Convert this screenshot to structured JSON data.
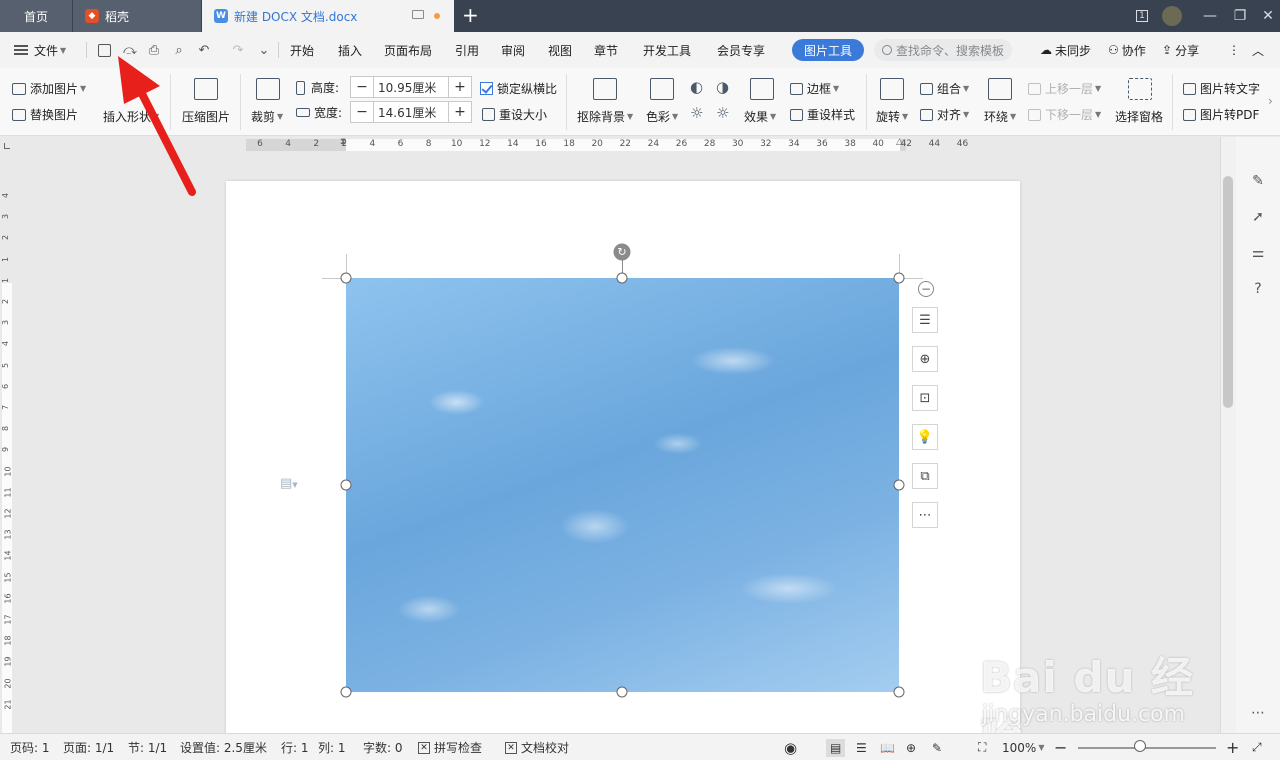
{
  "tabs": {
    "home": "首页",
    "daoke": "稻壳",
    "doc": "新建 DOCX 文档.docx",
    "doc_logo": "W"
  },
  "window": {
    "page_indicator": "1"
  },
  "menu": {
    "file": "文件",
    "items": [
      "开始",
      "插入",
      "页面布局",
      "引用",
      "审阅",
      "视图",
      "章节",
      "开发工具",
      "会员专享"
    ],
    "active_tab": "图片工具",
    "search_placeholder": "查找命令、搜索模板",
    "sync": "未同步",
    "collab": "协作",
    "share": "分享"
  },
  "toolbar": {
    "add_image": "添加图片",
    "replace_image": "替换图片",
    "insert_shape": "插入形状",
    "compress": "压缩图片",
    "crop": "裁剪",
    "height_label": "高度:",
    "height_value": "10.95厘米",
    "width_label": "宽度:",
    "width_value": "14.61厘米",
    "lock_ratio": "锁定纵横比",
    "reset_size": "重设大小",
    "remove_bg": "抠除背景",
    "color": "色彩",
    "effect": "效果",
    "border": "边框",
    "reset_style": "重设样式",
    "rotate": "旋转",
    "group": "组合",
    "align": "对齐",
    "wrap": "环绕",
    "bring_forward": "上移一层",
    "send_backward": "下移一层",
    "selection_pane": "选择窗格",
    "img_to_text": "图片转文字",
    "img_to_pdf": "图片转PDF"
  },
  "ruler_h": [
    "6",
    "4",
    "2",
    "2",
    "4",
    "6",
    "8",
    "10",
    "12",
    "14",
    "16",
    "18",
    "20",
    "22",
    "24",
    "26",
    "28",
    "30",
    "32",
    "34",
    "36",
    "38",
    "40",
    "42",
    "44",
    "46"
  ],
  "ruler_v": [
    "4",
    "3",
    "2",
    "1",
    "1",
    "2",
    "3",
    "4",
    "5",
    "6",
    "7",
    "8",
    "9",
    "10",
    "11",
    "12",
    "13",
    "14",
    "15",
    "16",
    "17",
    "18",
    "19",
    "20",
    "21"
  ],
  "statusbar": {
    "page_num": "页码: 1",
    "pages": "页面: 1/1",
    "section": "节: 1/1",
    "setting": "设置值: 2.5厘米",
    "row": "行: 1",
    "col": "列: 1",
    "words": "字数: 0",
    "spell_check": "拼写检查",
    "doc_proof": "文档校对",
    "zoom": "100%"
  },
  "zoom_level_fraction": 0.45,
  "watermark": {
    "brand": "Bai du 经验",
    "url": "jingyan.baidu.com"
  },
  "colors": {
    "accent": "#3b7ad8",
    "tab_bar": "#394250",
    "annotation_arrow": "#e8201c"
  }
}
